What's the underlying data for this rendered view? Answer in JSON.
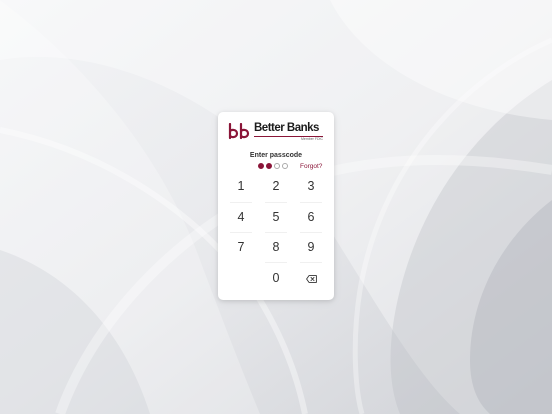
{
  "background": {
    "base": "#e7e8eb"
  },
  "brand": {
    "name": "Better Banks",
    "subtitle": "Member FDIC",
    "accent": "#8a1538"
  },
  "passcode": {
    "prompt": "Enter passcode",
    "entered_count": 2,
    "total_digits": 4,
    "forgot_label": "Forgot?"
  },
  "keypad": {
    "keys": [
      "1",
      "2",
      "3",
      "4",
      "5",
      "6",
      "7",
      "8",
      "9",
      "",
      "0",
      ""
    ],
    "backspace_icon": "backspace-icon"
  }
}
